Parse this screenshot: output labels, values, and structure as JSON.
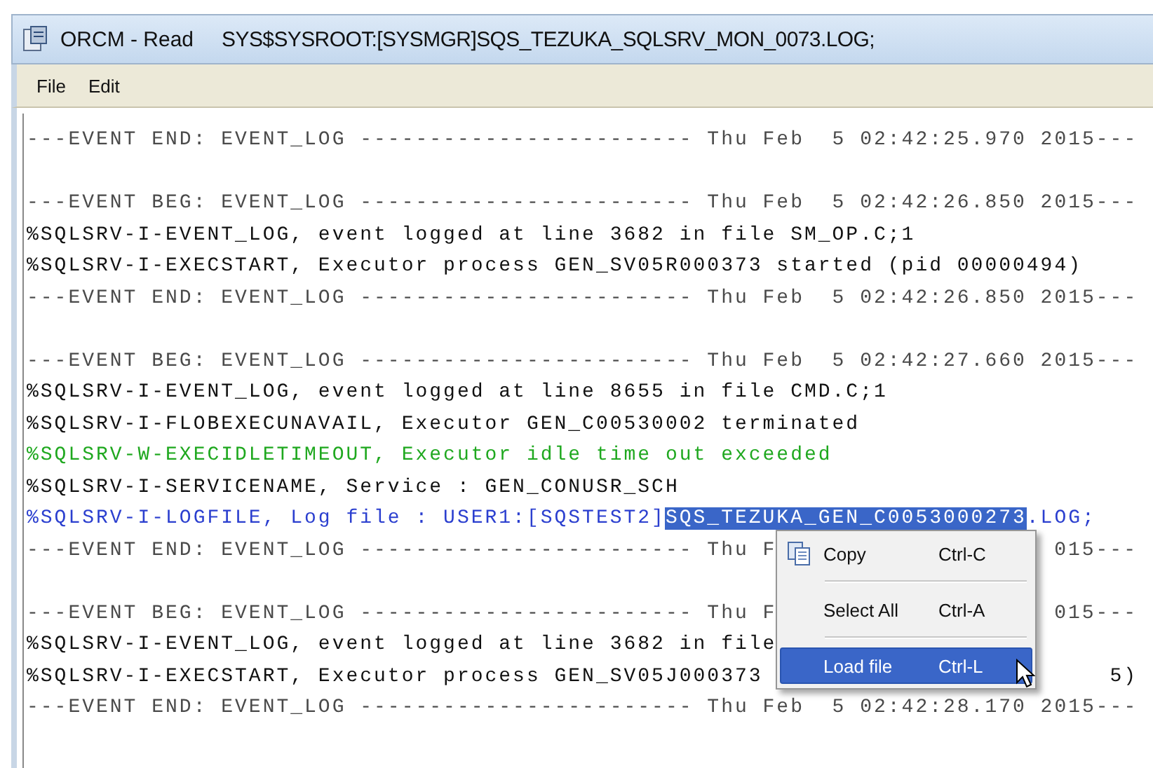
{
  "window": {
    "app_title": "ORCM - Read",
    "file_path": "SYS$SYSROOT:[SYSMGR]SQS_TEZUKA_SQLSRV_MON_0073.LOG;"
  },
  "menu_bar": [
    {
      "label": "File"
    },
    {
      "label": "Edit"
    }
  ],
  "log_lines": [
    {
      "kind": "separator",
      "text": "---EVENT END: EVENT_LOG ------------------------ Thu Feb  5 02:42:25.970 2015---"
    },
    {
      "kind": "blank"
    },
    {
      "kind": "separator",
      "text": "---EVENT BEG: EVENT_LOG ------------------------ Thu Feb  5 02:42:26.850 2015---"
    },
    {
      "kind": "info",
      "text": "%SQLSRV-I-EVENT_LOG, event logged at line 3682 in file SM_OP.C;1"
    },
    {
      "kind": "info",
      "text": "%SQLSRV-I-EXECSTART, Executor process GEN_SV05R000373 started (pid 00000494)"
    },
    {
      "kind": "separator",
      "text": "---EVENT END: EVENT_LOG ------------------------ Thu Feb  5 02:42:26.850 2015---"
    },
    {
      "kind": "blank"
    },
    {
      "kind": "separator",
      "text": "---EVENT BEG: EVENT_LOG ------------------------ Thu Feb  5 02:42:27.660 2015---"
    },
    {
      "kind": "info",
      "text": "%SQLSRV-I-EVENT_LOG, event logged at line 8655 in file CMD.C;1"
    },
    {
      "kind": "info",
      "text": "%SQLSRV-I-FLOBEXECUNAVAIL, Executor GEN_C00530002 terminated"
    },
    {
      "kind": "warning",
      "text": "%SQLSRV-W-EXECIDLETIMEOUT, Executor idle time out exceeded"
    },
    {
      "kind": "info",
      "text": "%SQLSRV-I-SERVICENAME, Service : GEN_CONUSR_SCH"
    },
    {
      "kind": "logfile",
      "text": "%SQLSRV-I-LOGFILE, Log file : USER1:[SQSTEST2]",
      "selected_text": "SQS_TEZUKA_GEN_C0053000273",
      "after_text": ".LOG;"
    },
    {
      "kind": "separator",
      "text": "---EVENT END: EVENT_LOG ------------------------ Thu F",
      "tail": "015---"
    },
    {
      "kind": "blank"
    },
    {
      "kind": "separator",
      "text": "---EVENT BEG: EVENT_LOG ------------------------ Thu F",
      "tail": "015---"
    },
    {
      "kind": "info",
      "text": "%SQLSRV-I-EVENT_LOG, event logged at line 3682 in file"
    },
    {
      "kind": "info",
      "text": "%SQLSRV-I-EXECSTART, Executor process GEN_SV05J000373",
      "tail": "5)"
    },
    {
      "kind": "separator",
      "text": "---EVENT END: EVENT_LOG ------------------------ Thu Feb  5 02:42:28.170 2015---"
    }
  ],
  "context_menu": {
    "items": [
      {
        "label": "Copy",
        "shortcut": "Ctrl-C",
        "selected": false
      },
      {
        "label": "Select All",
        "shortcut": "Ctrl-A",
        "selected": false
      },
      {
        "label": "Load file",
        "shortcut": "Ctrl-L",
        "selected": true
      }
    ]
  }
}
